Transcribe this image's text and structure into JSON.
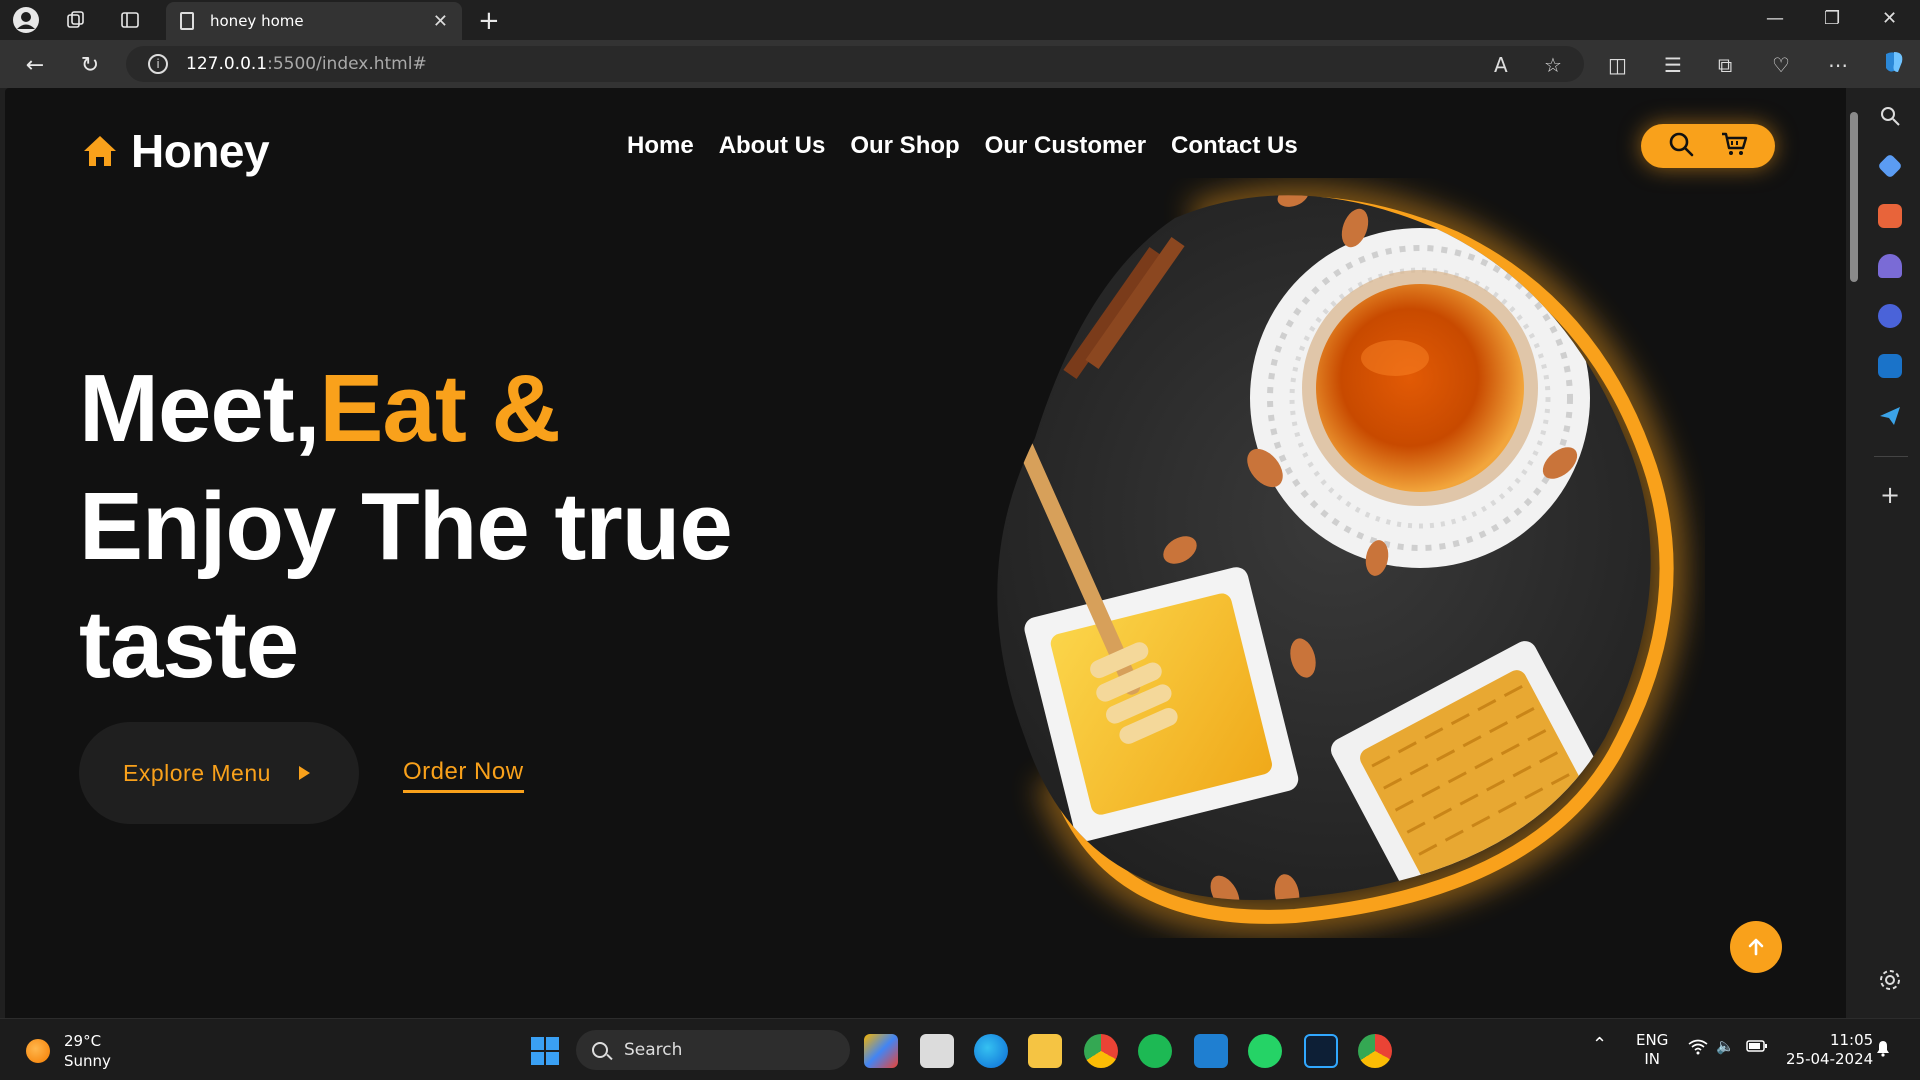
{
  "browser": {
    "tab_title": "honey home",
    "url_host": "127.0.0.1",
    "url_rest": ":5500/index.html#"
  },
  "site": {
    "brand": "Honey",
    "nav": [
      "Home",
      "About Us",
      "Our Shop",
      "Our Customer",
      "Contact Us"
    ],
    "hero": {
      "line1_white": "Meet,",
      "line1_accent": "Eat &",
      "line2": "Enjoy The true",
      "line3": "taste"
    },
    "buttons": {
      "explore": "Explore Menu",
      "order": "Order Now"
    },
    "colors": {
      "accent": "#f9a11b",
      "background": "#111111"
    }
  },
  "taskbar": {
    "weather_temp": "29°C",
    "weather_desc": "Sunny",
    "search_label": "Search",
    "lang_top": "ENG",
    "lang_bottom": "IN",
    "time": "11:05",
    "date": "25-04-2024"
  }
}
